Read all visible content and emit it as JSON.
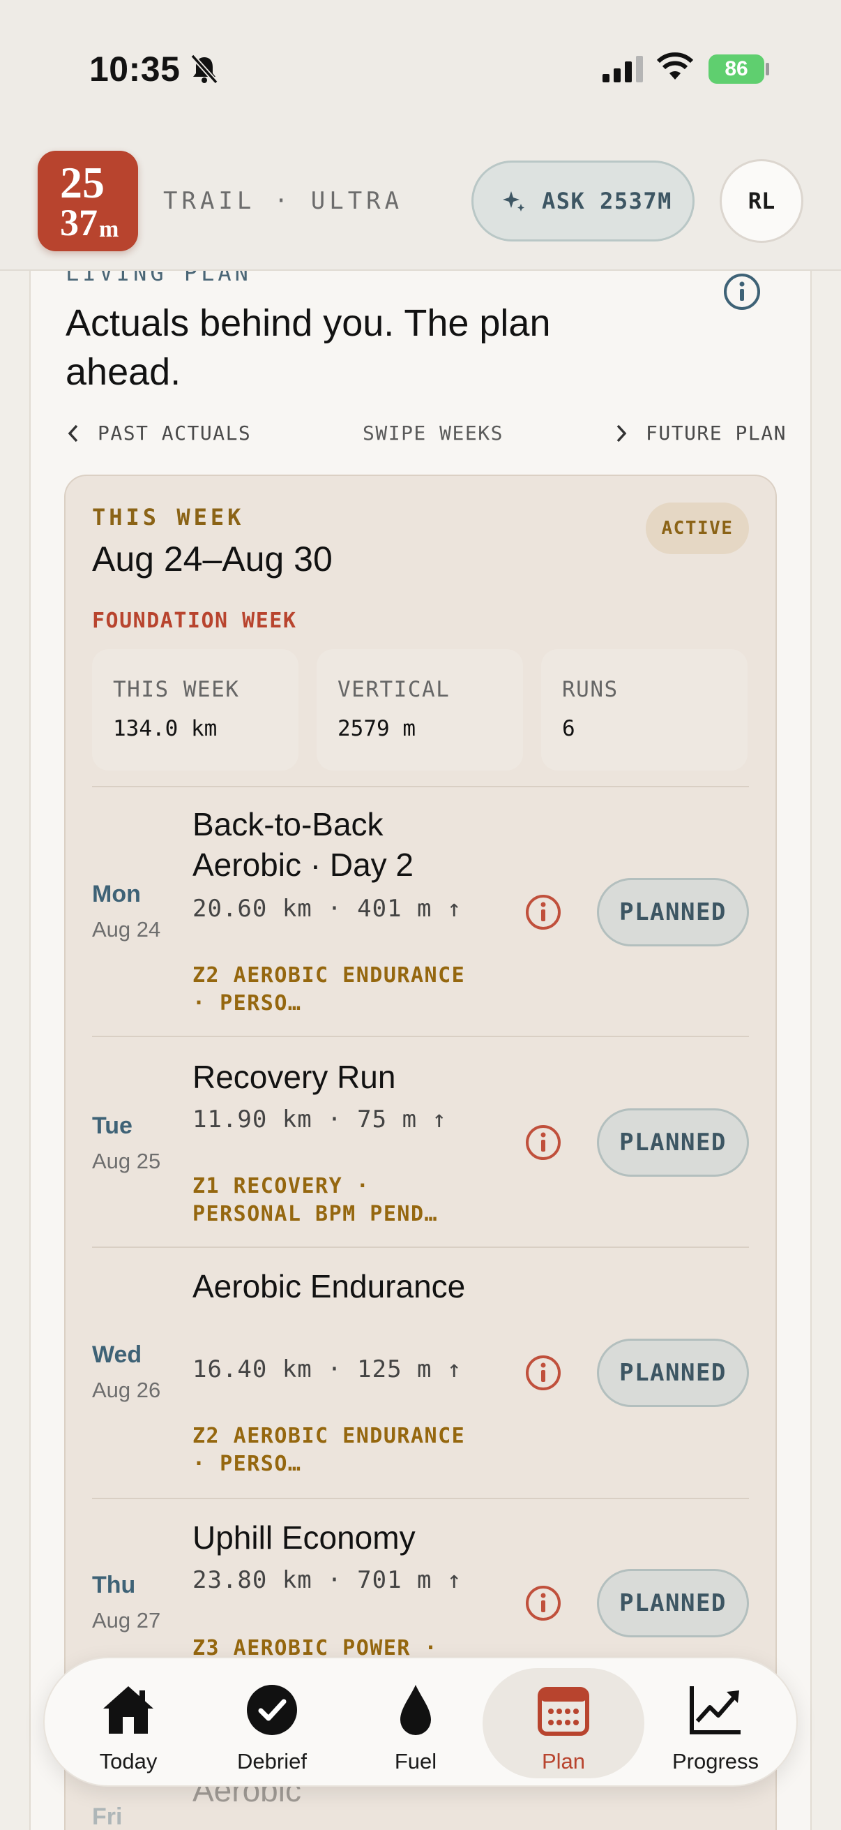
{
  "status": {
    "time": "10:35",
    "battery": "86"
  },
  "header": {
    "logo": {
      "line1": "25",
      "line2": "37",
      "suffix": "m"
    },
    "subtitle": "TRAIL · ULTRA",
    "ask_label": "ASK 2537M",
    "avatar_initials": "RL"
  },
  "plan": {
    "eyebrow": "LIVING PLAN",
    "headline": "Actuals behind you. The plan ahead.",
    "nav": {
      "prev": "PAST ACTUALS",
      "middle": "SWIPE WEEKS",
      "next": "FUTURE PLAN"
    }
  },
  "week": {
    "label": "THIS WEEK",
    "range": "Aug 24–Aug 30",
    "phase": "FOUNDATION WEEK",
    "badge": "ACTIVE",
    "stats": [
      {
        "label": "THIS WEEK",
        "value": "134.0 km"
      },
      {
        "label": "VERTICAL",
        "value": "2579 m"
      },
      {
        "label": "RUNS",
        "value": "6"
      }
    ]
  },
  "sessions": [
    {
      "day": "Mon",
      "date": "Aug 24",
      "title": "Back-to-Back Aerobic · Day 2",
      "meta": "20.60 km · 401 m ↑",
      "zone": "Z2 AEROBIC ENDURANCE · PERSO…",
      "status": "PLANNED"
    },
    {
      "day": "Tue",
      "date": "Aug 25",
      "title": "Recovery Run",
      "meta": "11.90 km · 75 m ↑",
      "zone": "Z1 RECOVERY · PERSONAL BPM PEND…",
      "status": "PLANNED"
    },
    {
      "day": "Wed",
      "date": "Aug 26",
      "title": "Aerobic Endurance",
      "meta": "16.40 km · 125 m ↑",
      "zone": "Z2 AEROBIC ENDURANCE · PERSO…",
      "status": "PLANNED"
    },
    {
      "day": "Thu",
      "date": "Aug 27",
      "title": "Uphill Economy",
      "meta": "23.80 km · 701 m ↑",
      "zone": "Z3 AEROBIC POWER ·",
      "status": "PLANNED"
    },
    {
      "day": "Fri",
      "title": "Aerobic"
    }
  ],
  "tabs": [
    {
      "label": "Today",
      "icon": "home-icon"
    },
    {
      "label": "Debrief",
      "icon": "check-circle-icon"
    },
    {
      "label": "Fuel",
      "icon": "drop-icon"
    },
    {
      "label": "Plan",
      "icon": "calendar-icon",
      "active": true
    },
    {
      "label": "Progress",
      "icon": "trend-chart-icon"
    }
  ],
  "colors": {
    "accent": "#b8442e",
    "gold": "#8b6316",
    "slate": "#3e6276"
  }
}
